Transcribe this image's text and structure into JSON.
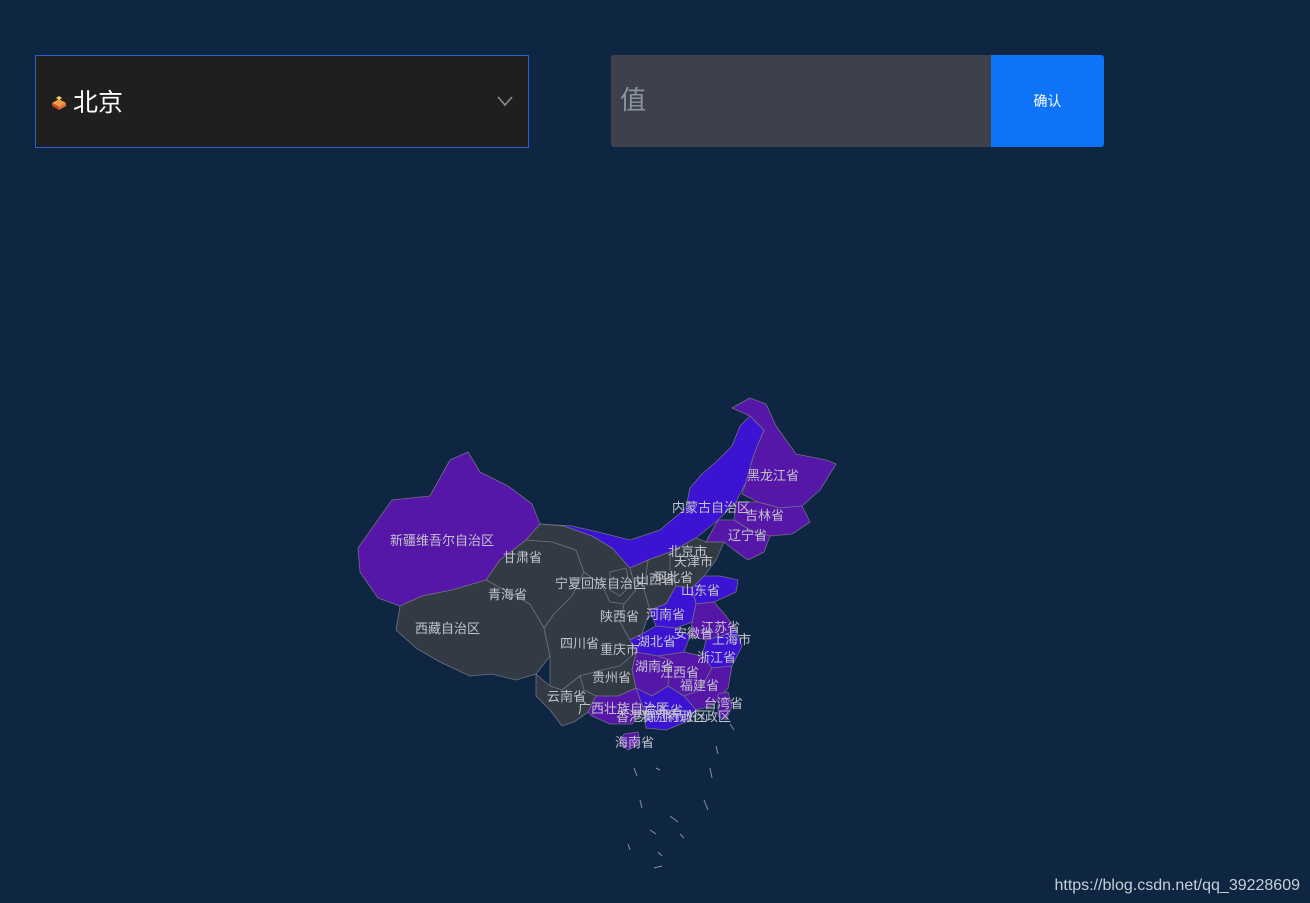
{
  "city_select": {
    "selected": "北京",
    "flag_icon": "china-flag-icon",
    "arrow_icon": "chevron-down-icon"
  },
  "value_input": {
    "placeholder": "值",
    "value": ""
  },
  "confirm_button": {
    "label": "确认",
    "color": "#0e73f6"
  },
  "colors": {
    "background": "#0e2642",
    "region_default": "#323a43",
    "region_highlight_blue": "#3c12d3",
    "region_highlight_purple": "#5616a8"
  },
  "map": {
    "labels": {
      "heilongjiang": "黑龙江省",
      "neimenggu": "内蒙古自治区",
      "jilin": "吉林省",
      "liaoning": "辽宁省",
      "xinjiang": "新疆维吾尔自治区",
      "gansu": "甘肃省",
      "beijing": "北京市",
      "tianjin": "天津市",
      "ningxia": "宁夏回族自治区",
      "shanxi": "山西省",
      "hebei": "河北省",
      "qinghai": "青海省",
      "shandong": "山东省",
      "shaanxi": "陕西省",
      "henan": "河南省",
      "xizang": "西藏自治区",
      "jiangsu": "江苏省",
      "anhui": "安徽省",
      "hubei": "湖北省",
      "shanghai": "上海市",
      "sichuan": "四川省",
      "chongqing": "重庆市",
      "zhejiang": "浙江省",
      "hunan": "湖南省",
      "jiangxi": "江西省",
      "guizhou": "贵州省",
      "fujian": "福建省",
      "yunnan": "云南省",
      "taiwan": "台湾省",
      "guangxi": "广西壮族自治区",
      "guangdong": "广东省",
      "xianggang": "香港特别行政区",
      "aomen": "澳门特别行政区",
      "hainan": "海南省"
    }
  },
  "watermark": "https://blog.csdn.net/qq_39228609"
}
